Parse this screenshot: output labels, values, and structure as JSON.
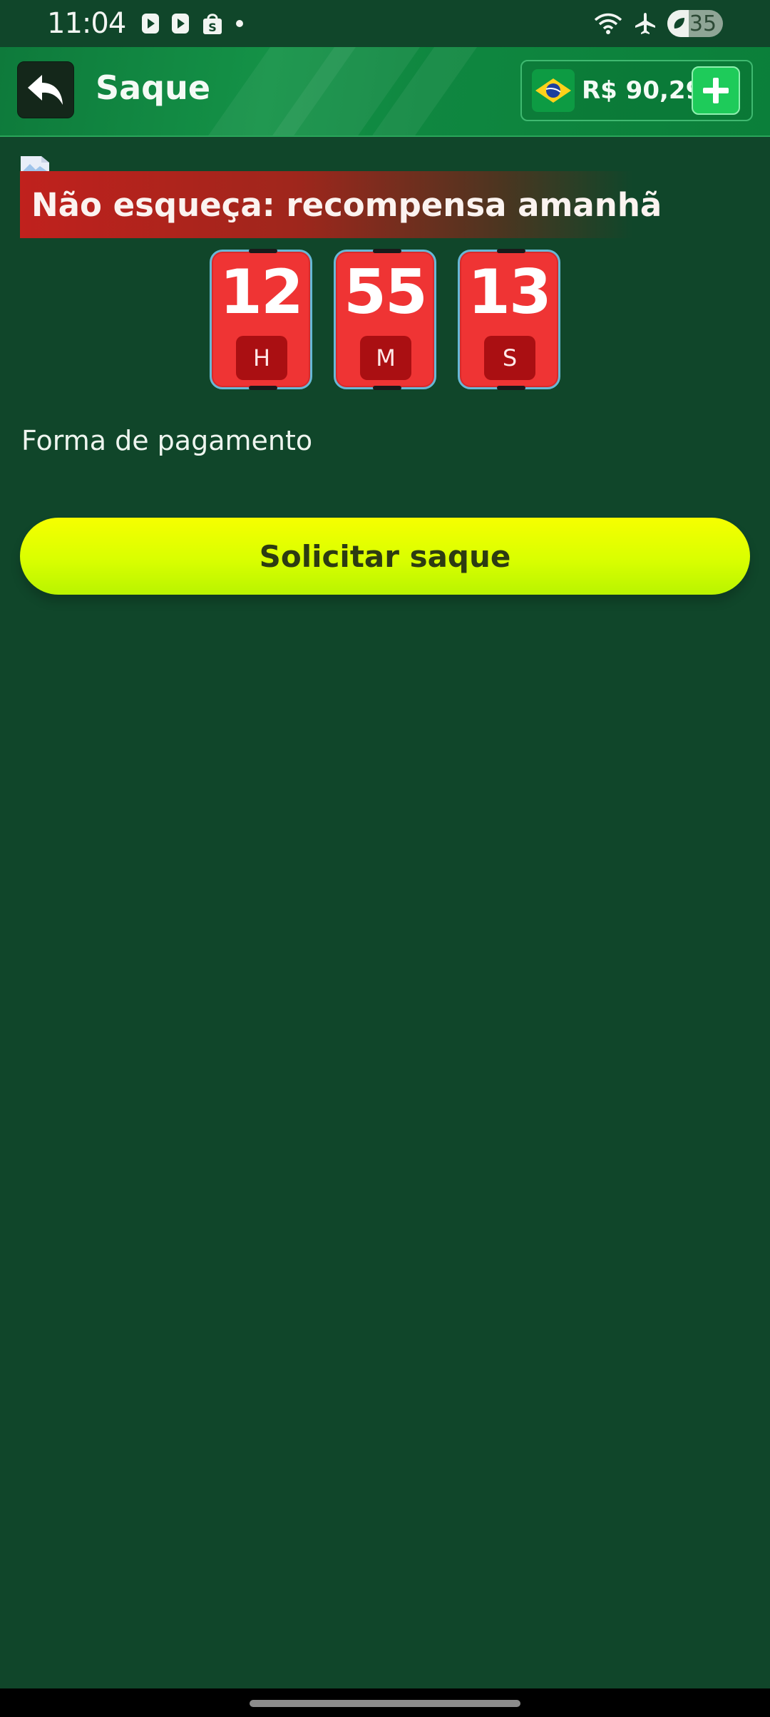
{
  "status_bar": {
    "time": "11:04",
    "battery_level": "35",
    "icons": [
      "play-icon",
      "play-icon",
      "shopping-bag-icon",
      "dot-icon",
      "wifi-icon",
      "airplane-icon",
      "battery-saver-icon"
    ]
  },
  "header": {
    "title": "Saque",
    "balance": "R$ 90,29",
    "flag_icon": "brazil-flag-icon",
    "back_icon": "back-arrow-icon",
    "add_icon": "plus-icon"
  },
  "reminder": {
    "text": "Não esqueça: recompensa amanhã"
  },
  "timer": {
    "hours": "12",
    "minutes": "55",
    "seconds": "13",
    "hours_unit": "H",
    "minutes_unit": "M",
    "seconds_unit": "S"
  },
  "payment": {
    "label": "Forma de pagamento"
  },
  "actions": {
    "withdraw_label": "Solicitar saque"
  },
  "colors": {
    "background": "#10462a",
    "header": "#0e7a3b",
    "timer_card": "#ef3434",
    "button": "#e0ff00"
  }
}
